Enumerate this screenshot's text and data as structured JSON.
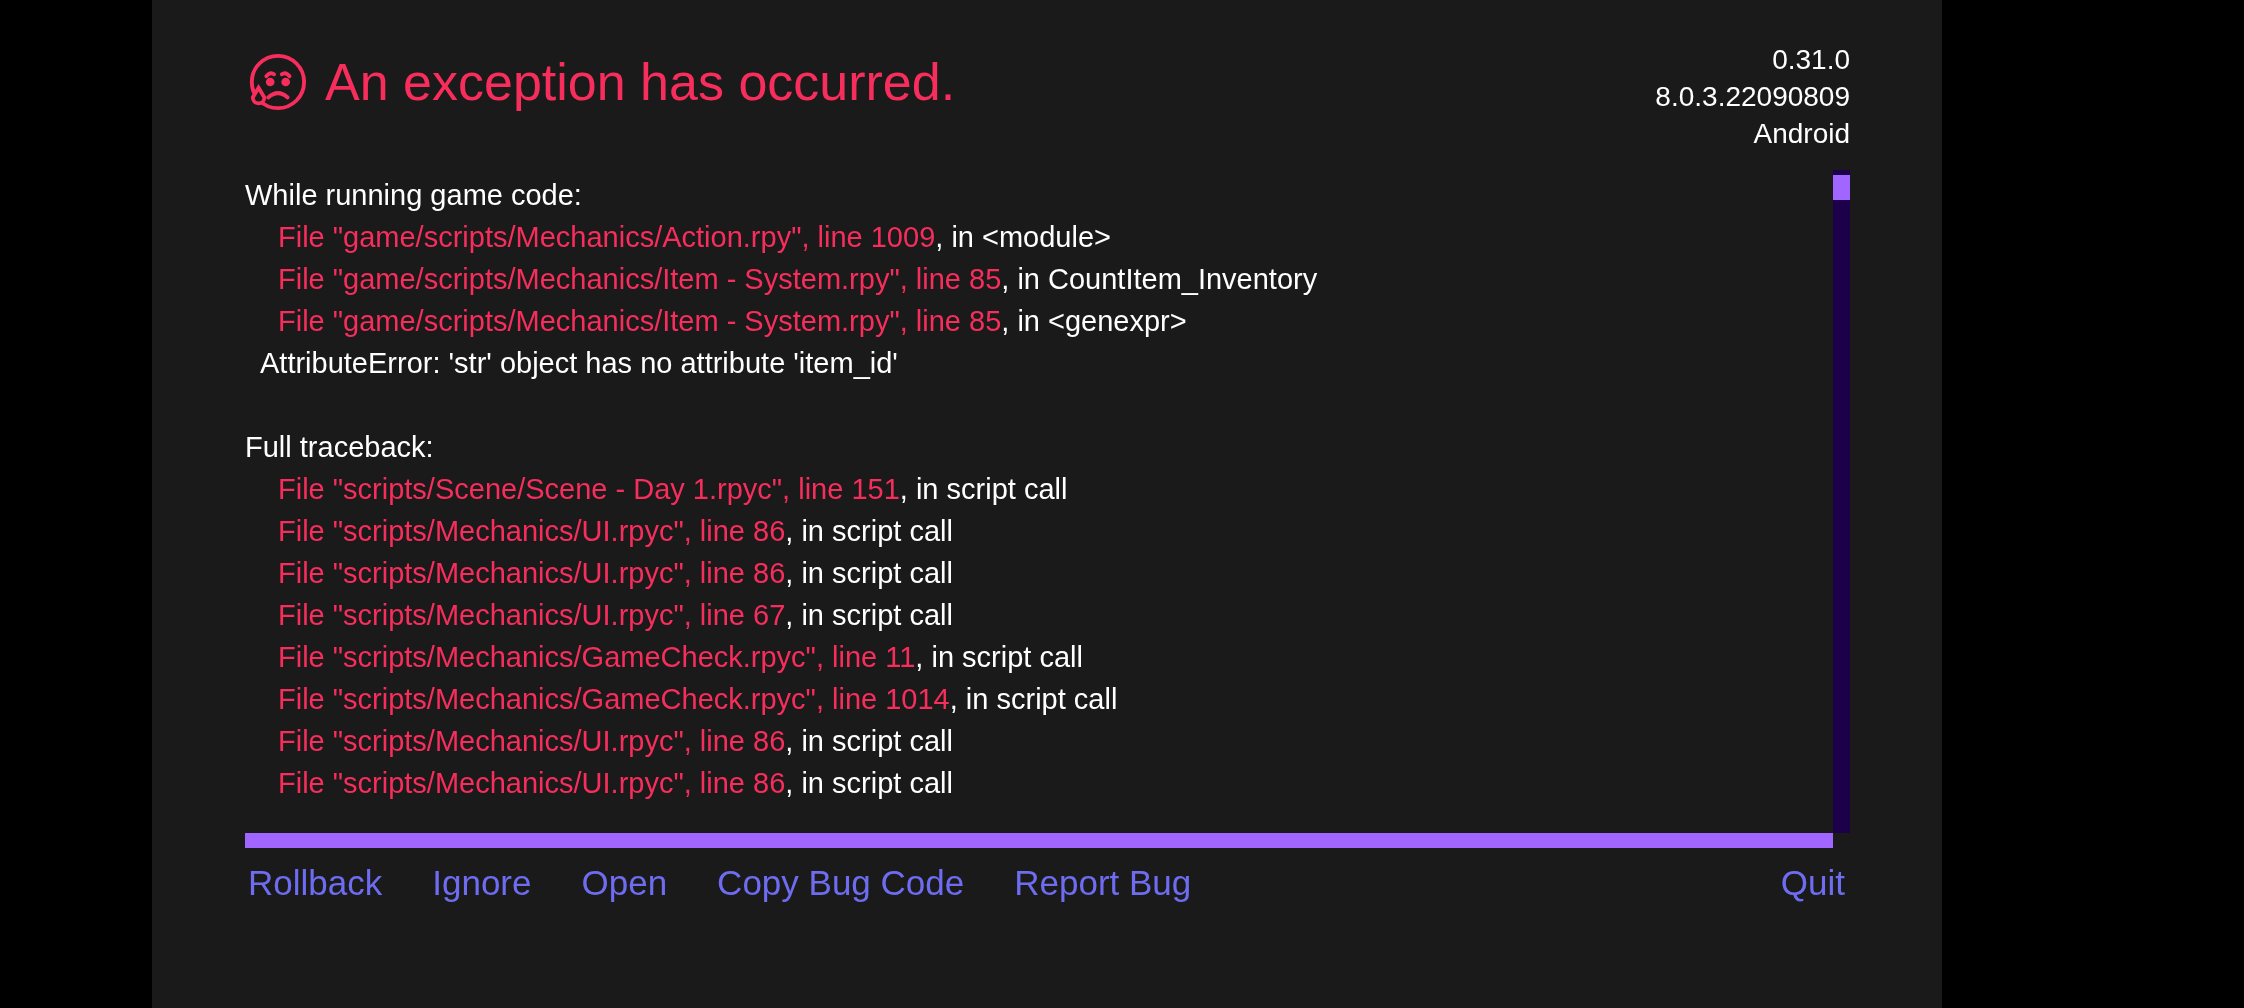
{
  "header": {
    "title": "An exception has occurred.",
    "version_info": [
      "0.31.0",
      "8.0.3.22090809",
      "Android"
    ]
  },
  "sections": [
    {
      "heading": "While running game code:",
      "frames": [
        {
          "location": "File \"game/scripts/Mechanics/Action.rpy\", line 1009",
          "context": ", in <module>"
        },
        {
          "location": "File \"game/scripts/Mechanics/Item - System.rpy\", line 85",
          "context": ", in CountItem_Inventory"
        },
        {
          "location": "File \"game/scripts/Mechanics/Item - System.rpy\", line 85",
          "context": ", in <genexpr>"
        }
      ],
      "error": "AttributeError: 'str' object has no attribute 'item_id'"
    },
    {
      "heading": "Full traceback:",
      "frames": [
        {
          "location": "File \"scripts/Scene/Scene - Day 1.rpyc\", line 151",
          "context": ", in script call"
        },
        {
          "location": "File \"scripts/Mechanics/UI.rpyc\", line 86",
          "context": ", in script call"
        },
        {
          "location": "File \"scripts/Mechanics/UI.rpyc\", line 86",
          "context": ", in script call"
        },
        {
          "location": "File \"scripts/Mechanics/UI.rpyc\", line 67",
          "context": ", in script call"
        },
        {
          "location": "File \"scripts/Mechanics/GameCheck.rpyc\", line 11",
          "context": ", in script call"
        },
        {
          "location": "File \"scripts/Mechanics/GameCheck.rpyc\", line 1014",
          "context": ", in script call"
        },
        {
          "location": "File \"scripts/Mechanics/UI.rpyc\", line 86",
          "context": ", in script call"
        },
        {
          "location": "File \"scripts/Mechanics/UI.rpyc\", line 86",
          "context": ", in script call"
        }
      ]
    }
  ],
  "actions": {
    "left": [
      "Rollback",
      "Ignore",
      "Open",
      "Copy Bug Code",
      "Report Bug"
    ],
    "right": [
      "Quit"
    ]
  }
}
